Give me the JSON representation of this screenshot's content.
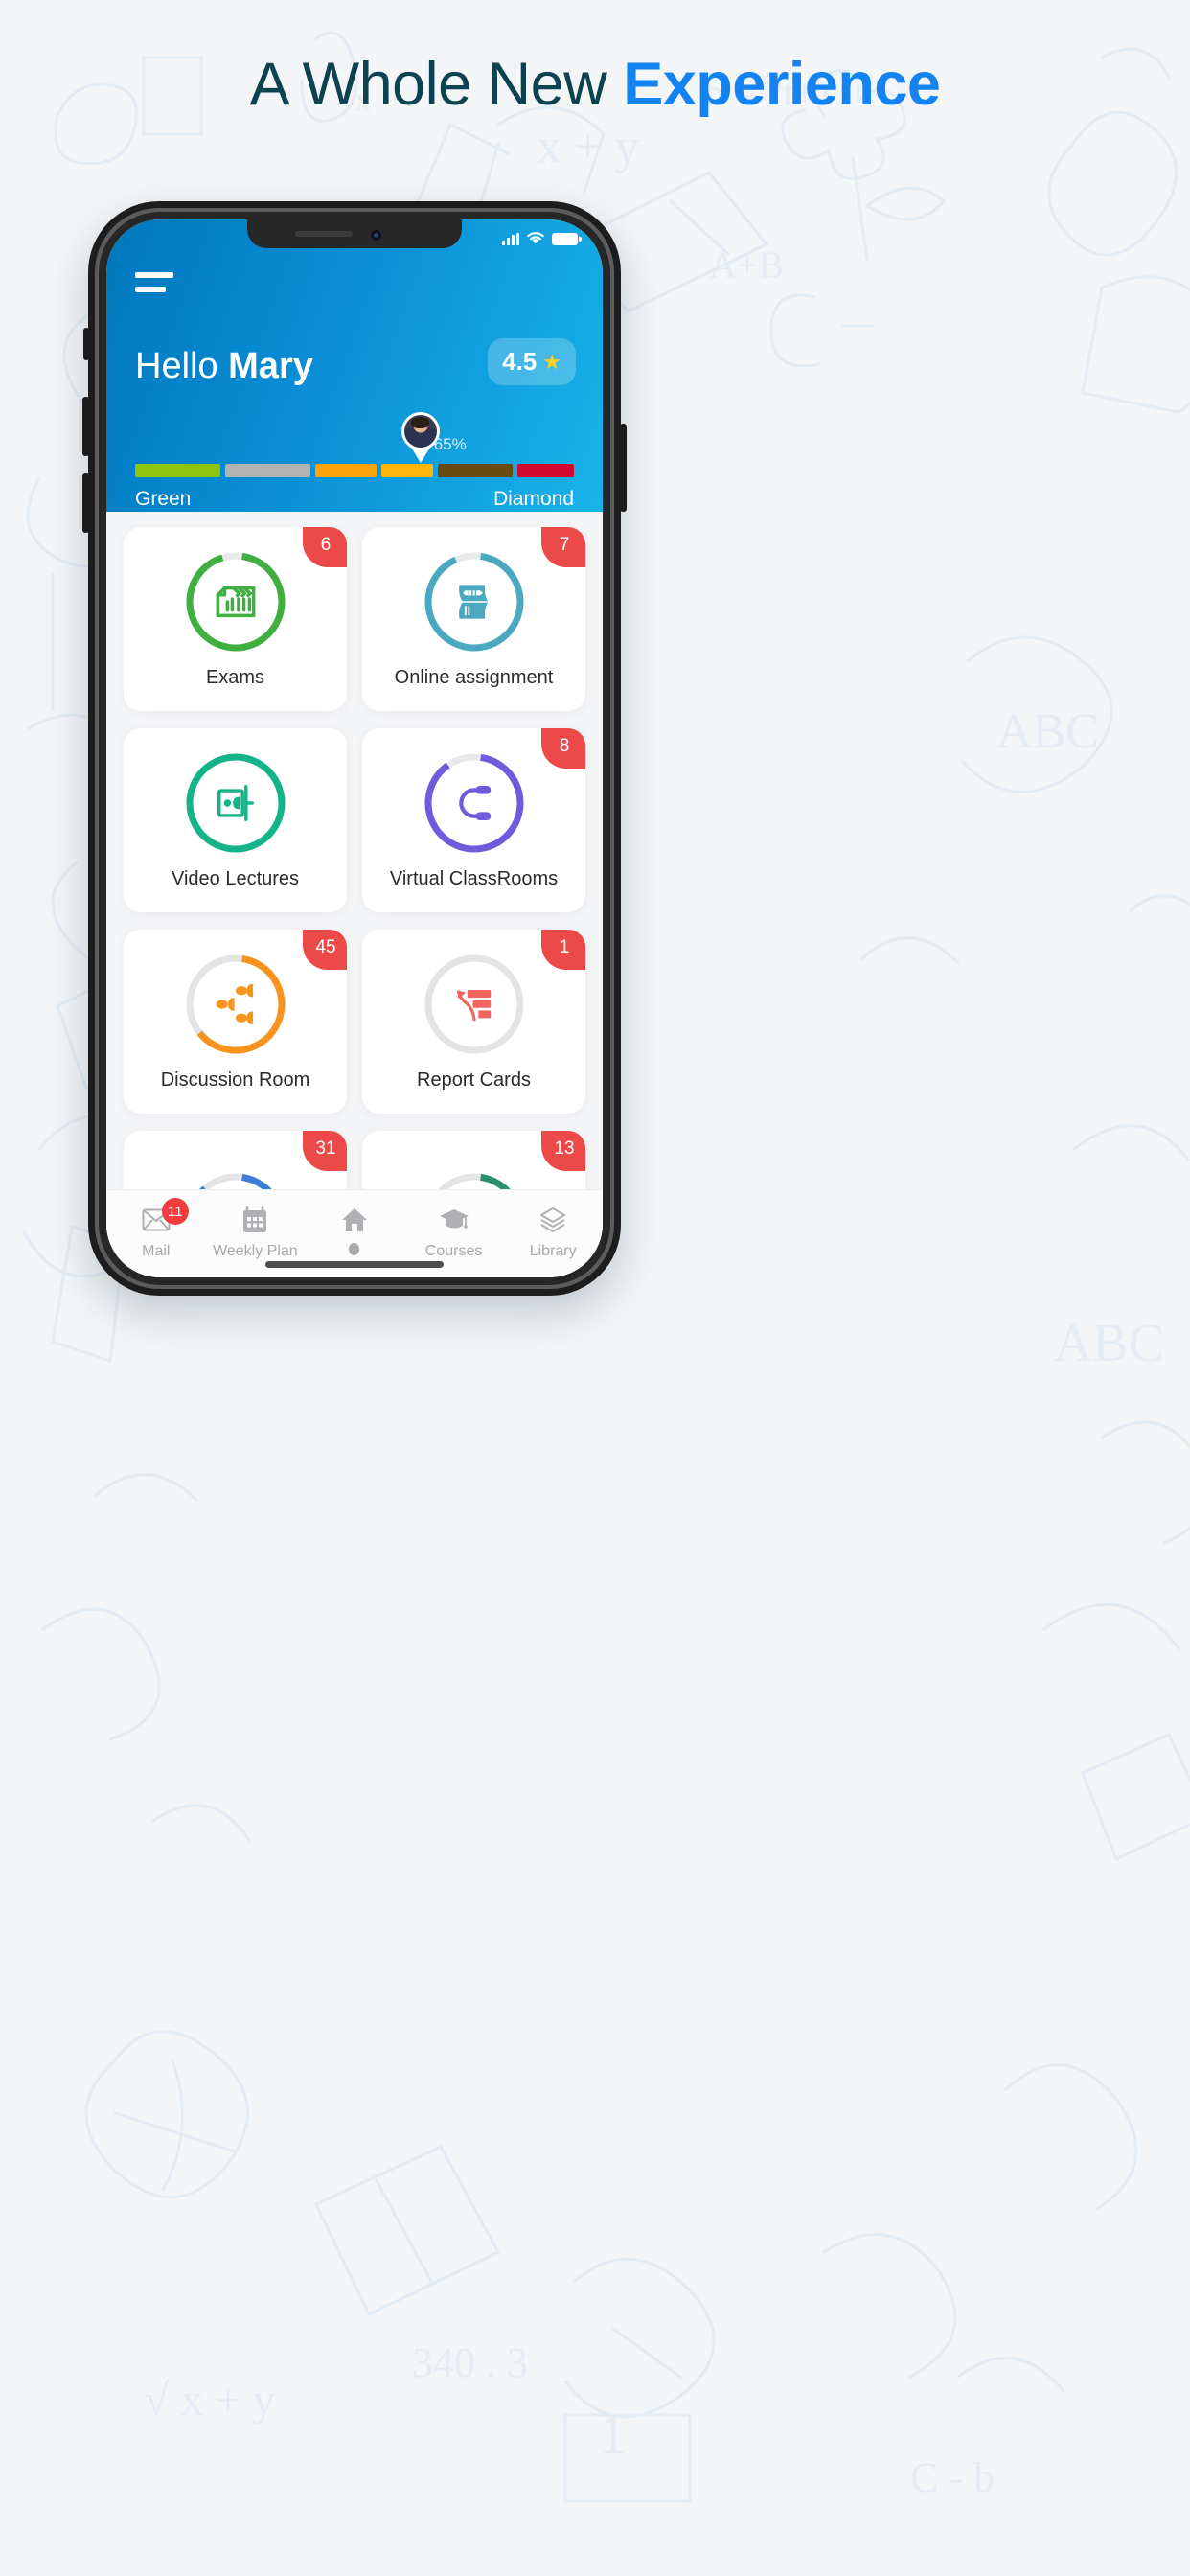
{
  "headline": {
    "plain": "A Whole New ",
    "accent": "Experience"
  },
  "colors": {
    "headline_plain": "#0d4251",
    "headline_accent": "#1283f0",
    "header_blue": "#0a8fd6",
    "badge_red": "#ec4a48"
  },
  "phone": {
    "statusbar": {
      "signal_icon": "signal-bars-icon",
      "wifi_icon": "wifi-icon",
      "battery_icon": "battery-icon"
    },
    "header": {
      "menu_icon": "hamburger-menu-icon",
      "greeting_prefix": "Hello ",
      "user_name": "Mary",
      "rating_value": "4.5",
      "rating_star_icon": "star-icon",
      "avatar_icon": "user-avatar-pin",
      "progress_percent_label": "65%",
      "progress_percent": 65,
      "rank_start_label": "Green",
      "rank_end_label": "Diamond",
      "rank_segments": [
        {
          "color": "#8cc60e",
          "flex": 1.65
        },
        {
          "color": "#b2b2b2",
          "flex": 1.65
        },
        {
          "color": "#ffa30a",
          "flex": 1.2
        },
        {
          "color": "#ffb50c",
          "flex": 1.0
        },
        {
          "color": "#6b4a12",
          "flex": 1.45
        },
        {
          "color": "#d1092e",
          "flex": 1.1
        }
      ]
    },
    "cards": [
      {
        "label": "Exams",
        "badge": "6",
        "ring_color": "#3faf3f",
        "track_color": "#e8e9eb",
        "progress": 93,
        "icon": "checklist-document-icon"
      },
      {
        "label": "Online assignment",
        "badge": "7",
        "ring_color": "#4aa8c0",
        "track_color": "#e8e9eb",
        "progress": 91,
        "icon": "open-book-pencil-icon"
      },
      {
        "label": "Video Lectures",
        "badge": "",
        "ring_color": "#13b588",
        "track_color": "#e8e9eb",
        "progress": 100,
        "icon": "video-presenter-icon"
      },
      {
        "label": "Virtual ClassRooms",
        "badge": "8",
        "ring_color": "#6f5bdc",
        "track_color": "#e8e9eb",
        "progress": 88,
        "icon": "headphones-icon"
      },
      {
        "label": "Discussion Room",
        "badge": "45",
        "ring_color": "#f7931e",
        "track_color": "#e3e4e6",
        "progress": 62,
        "icon": "group-people-icon"
      },
      {
        "label": "Report Cards",
        "badge": "1",
        "ring_color": "#e3e4e6",
        "track_color": "#e3e4e6",
        "progress": 0,
        "icon": "bar-chart-arrow-icon"
      },
      {
        "label": "",
        "badge": "31",
        "ring_color": "#3b7fd4",
        "track_color": "#e3e4e6",
        "progress": 86,
        "icon": "partial-card-icon"
      },
      {
        "label": "",
        "badge": "13",
        "ring_color": "#2a8f6b",
        "track_color": "#e3e4e6",
        "progress": 84,
        "icon": "partial-card-icon"
      }
    ],
    "bottom_nav": [
      {
        "label": "Mail",
        "icon": "mail-envelope-icon",
        "badge": "11",
        "active": false
      },
      {
        "label": "Weekly Plan",
        "icon": "calendar-icon",
        "badge": "",
        "active": false
      },
      {
        "label": "",
        "icon": "home-icon",
        "badge": "",
        "active": true
      },
      {
        "label": "Courses",
        "icon": "graduation-cap-icon",
        "badge": "",
        "active": false
      },
      {
        "label": "Library",
        "icon": "books-stack-icon",
        "badge": "",
        "active": false
      }
    ]
  }
}
